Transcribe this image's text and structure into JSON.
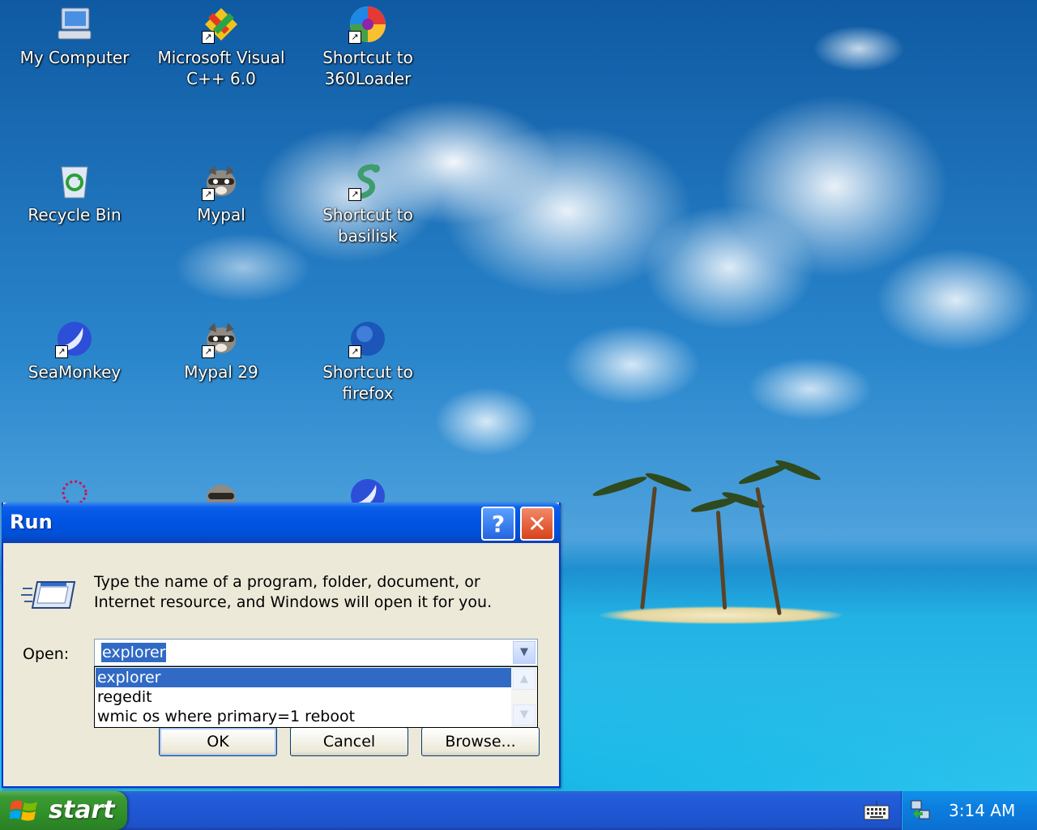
{
  "desktop": {
    "icons": [
      {
        "label": "My Computer",
        "icon": "computer-icon"
      },
      {
        "label": "Microsoft Visual C++ 6.0",
        "icon": "visual-cpp-icon"
      },
      {
        "label": "Shortcut to 360Loader",
        "icon": "360loader-icon"
      },
      {
        "label": "Recycle Bin",
        "icon": "recycle-bin-icon"
      },
      {
        "label": "Mypal",
        "icon": "raccoon-icon"
      },
      {
        "label": "Shortcut to basilisk",
        "icon": "basilisk-icon"
      },
      {
        "label": "SeaMonkey",
        "icon": "seamonkey-icon"
      },
      {
        "label": "Mypal 29",
        "icon": "raccoon-icon"
      },
      {
        "label": "Shortcut to firefox",
        "icon": "firefox-icon"
      }
    ],
    "icon_label_lines": {
      "my_computer": "My Computer",
      "vcpp_1": "Microsoft Visual",
      "vcpp_2": "C++ 6.0",
      "loader_1": "Shortcut to",
      "loader_2": "360Loader",
      "recycle": "Recycle Bin",
      "mypal": "Mypal",
      "basilisk_1": "Shortcut to",
      "basilisk_2": "basilisk",
      "seamonkey": "SeaMonkey",
      "mypal29": "Mypal 29",
      "firefox": "Shortcut to firefox"
    }
  },
  "run_dialog": {
    "title": "Run",
    "help_label": "?",
    "close_label": "✕",
    "description_line1": "Type the name of a program, folder, document, or",
    "description_line2": "Internet resource, and Windows will open it for you.",
    "open_label": "Open:",
    "open_value": "explorer",
    "dropdown_items": [
      "explorer",
      "regedit",
      "wmic os where primary=1 reboot"
    ],
    "selected_item": "explorer",
    "ok_label": "OK",
    "cancel_label": "Cancel",
    "browse_label": "Browse..."
  },
  "taskbar": {
    "start_label": "start",
    "clock": "3:14 AM"
  },
  "colors": {
    "titlebar": "#0054e3",
    "close_button": "#d9411a",
    "selection": "#316ac5",
    "start_button": "#3c9a34",
    "taskbar": "#245edb",
    "tray": "#0c7fe0"
  }
}
